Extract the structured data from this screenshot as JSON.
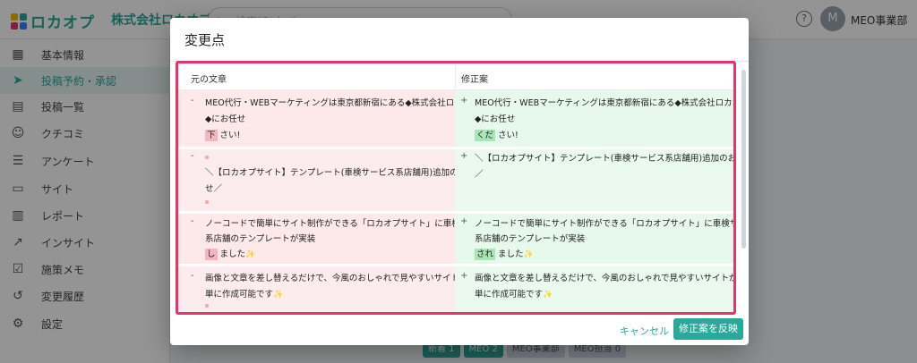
{
  "app": {
    "logo_text": "ロカオプ",
    "company": "株式会社ロカオプ",
    "search_placeholder": "検索(Ctrl+/)",
    "avatar_initial": "M",
    "user_name": "MEO事業部",
    "brand_color": "#2aa89a"
  },
  "sidebar": {
    "items": [
      {
        "label": "基本情報",
        "icon": "storefront-icon"
      },
      {
        "label": "投稿予約・承認",
        "icon": "send-icon",
        "active": true
      },
      {
        "label": "投稿一覧",
        "icon": "document-icon"
      },
      {
        "label": "クチコミ",
        "icon": "reviews-icon"
      },
      {
        "label": "アンケート",
        "icon": "list-icon"
      },
      {
        "label": "サイト",
        "icon": "window-icon"
      },
      {
        "label": "レポート",
        "icon": "report-icon"
      },
      {
        "label": "インサイト",
        "icon": "trending-icon"
      },
      {
        "label": "施策メモ",
        "icon": "checklist-icon"
      },
      {
        "label": "変更履歴",
        "icon": "history-icon"
      },
      {
        "label": "設定",
        "icon": "gear-icon"
      }
    ]
  },
  "bottom_tags": [
    "新着 1",
    "MEO 2",
    "MEO事業部",
    "MEO担当 0"
  ],
  "modal": {
    "title": "変更点",
    "original_header": "元の文章",
    "revised_header": "修正案",
    "minus": "-",
    "plus": "+",
    "hunks": [
      {
        "left": {
          "lines": [
            "MEO代行・WEBマーケティングは東京都新宿にある◆株式会社ロカオプ",
            "◆にお任せ"
          ],
          "hl": "下",
          "tail": "さい!"
        },
        "right": {
          "lines": [
            "MEO代行・WEBマーケティングは東京都新宿にある◆株式会社ロカオプ",
            "◆にお任せ"
          ],
          "hl": "くだ",
          "tail": "さい!"
        }
      },
      {
        "left": {
          "lines": [
            "＼【ロカオプサイト】テンプレート(車検サービス系店舗用)追加のお知ら",
            "せ／"
          ]
        },
        "right": {
          "lines": [
            "＼【ロカオプサイト】テンプレート(車検サービス系店舗用)追加のお知らせ",
            "／"
          ]
        }
      },
      {
        "left": {
          "lines": [
            "ノーコードで簡単にサイト制作ができる「ロカオプサイト」に車検サービス",
            "系店舗のテンプレートが実装"
          ],
          "hl": "し",
          "tail": "ました"
        },
        "right": {
          "lines": [
            "ノーコードで簡単にサイト制作ができる「ロカオプサイト」に車検サービス",
            "系店舗のテンプレートが実装"
          ],
          "hl": "され",
          "tail": "ました"
        }
      },
      {
        "left": {
          "lines": [
            "画像と文章を差し替えるだけで、今風のおしゃれで見やすいサイトが簡",
            "単に作成可能です"
          ]
        },
        "right": {
          "lines": [
            "画像と文章を差し替えるだけで、今風のおしゃれで見やすいサイトが簡",
            "単に作成可能です"
          ]
        }
      }
    ],
    "cancel_label": "キャンセル",
    "apply_label": "修正案を反映",
    "highlight_border_color": "#e7336b"
  }
}
